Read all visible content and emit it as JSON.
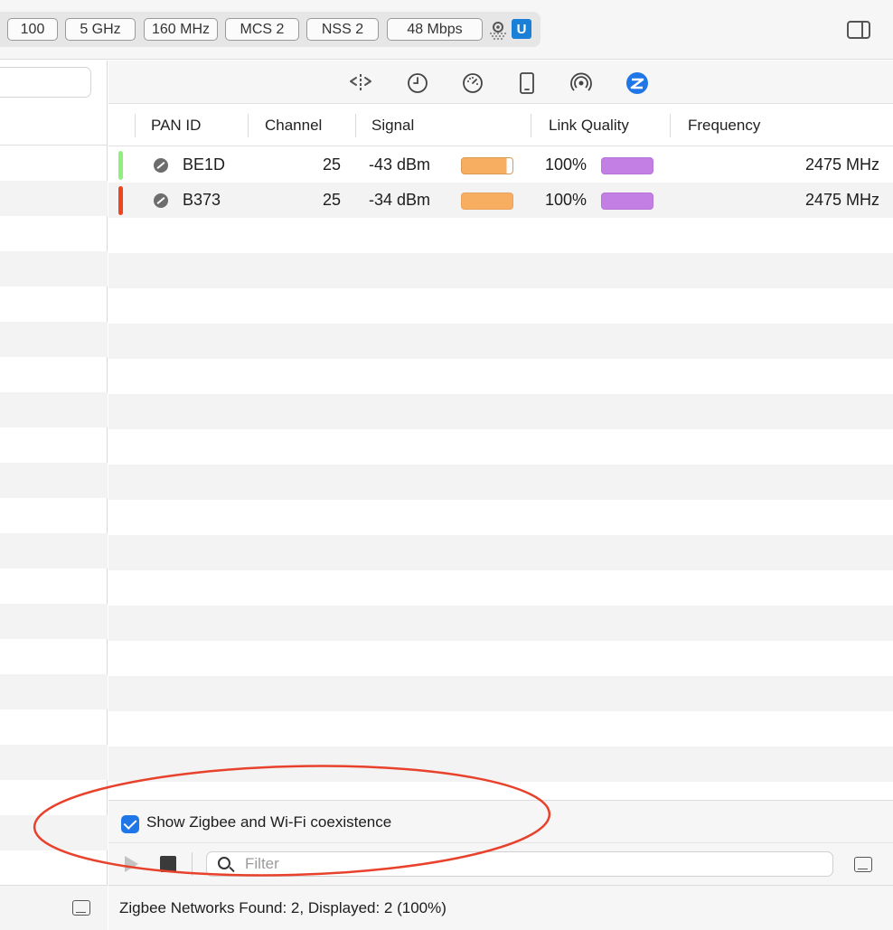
{
  "toolbar": {
    "pills": [
      "100",
      "5 GHz",
      "160 MHz",
      "MCS 2",
      "NSS 2",
      "48 Mbps"
    ],
    "ubiquiti_badge": "U"
  },
  "tabs": [
    "wifi-scan-icon",
    "clock-icon",
    "gauge-icon",
    "phone-icon",
    "signal-broadcast-icon",
    "zigbee-icon"
  ],
  "table": {
    "columns": [
      "PAN ID",
      "Channel",
      "Signal",
      "Link Quality",
      "Frequency"
    ],
    "rows": [
      {
        "pan_id": "BE1D",
        "channel": "25",
        "signal": "-43 dBm",
        "signal_level": 0.88,
        "link_quality": "100%",
        "link_quality_level": 1.0,
        "frequency": "2475 MHz",
        "marker_color": "#8ef07c"
      },
      {
        "pan_id": "B373",
        "channel": "25",
        "signal": "-34 dBm",
        "signal_level": 1.0,
        "link_quality": "100%",
        "link_quality_level": 1.0,
        "frequency": "2475 MHz",
        "marker_color": "#f0441c"
      }
    ]
  },
  "coexistence": {
    "checked": true,
    "label": "Show Zigbee and Wi-Fi coexistence"
  },
  "filter": {
    "placeholder": "Filter"
  },
  "status": {
    "text": "Zigbee Networks Found: 2, Displayed: 2 (100%)"
  },
  "colors": {
    "accent": "#1f76e6",
    "signal": "#f8ae61",
    "link_quality": "#c47fe4",
    "annotation": "#e8412c"
  }
}
